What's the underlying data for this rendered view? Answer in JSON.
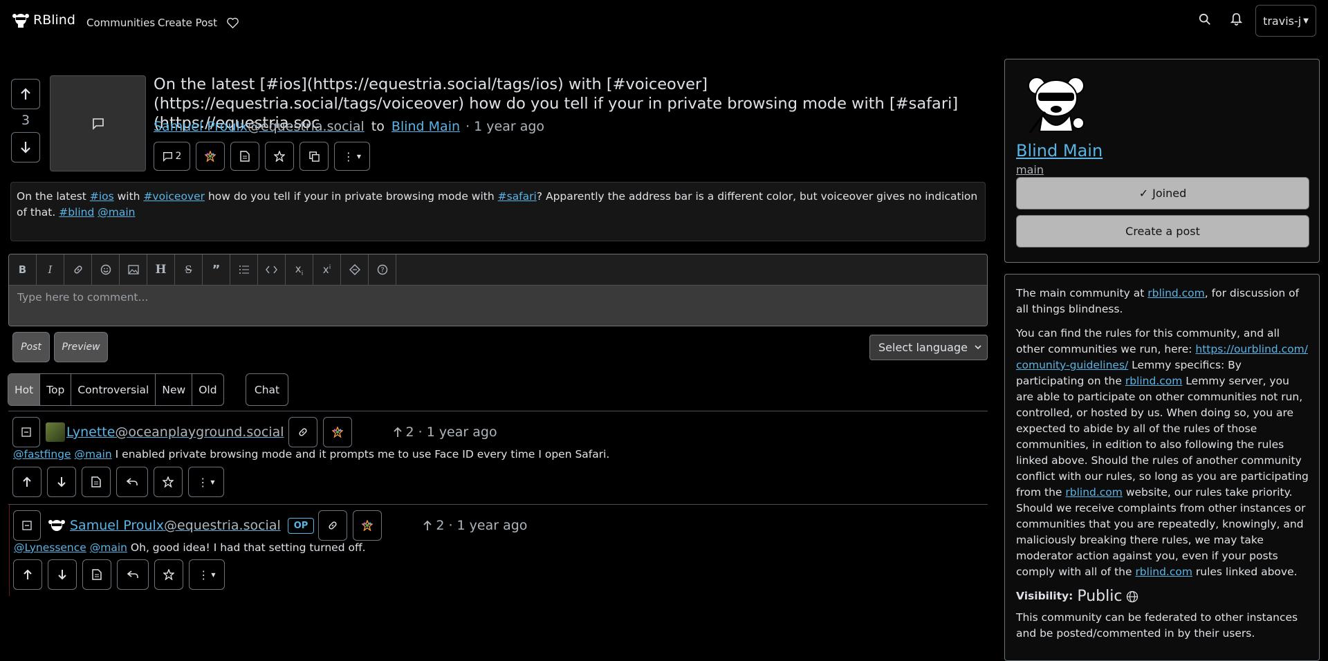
{
  "nav": {
    "brand": "RBlind",
    "communities": "Communities",
    "create_post": "Create Post",
    "user": "travis-j",
    "icons": [
      "heart-icon",
      "search-icon",
      "bell-icon"
    ]
  },
  "post": {
    "score": "3",
    "title": "On the latest [#ios](https://equestria.social/tags/ios) with [#voiceover](https://equestria.social/tags/voiceover) how do you tell if your in private browsing mode with [#safari](https://equestria.soc",
    "author_name": "Samuel Proulx",
    "author_instance": "@equestria.social",
    "to": "to",
    "community": "Blind Main",
    "time": "· 1 year ago",
    "comment_count": "2",
    "body": {
      "t1": "On the latest ",
      "l1": "#ios",
      "t2": " with ",
      "l2": "#voiceover",
      "t3": " how do you tell if your in private browsing mode with ",
      "l3": "#safari",
      "t4": "? Apparently the address bar is a different color, but voiceover gives no indication of that. ",
      "l4": "#blind",
      "t5": " ",
      "l5": "@main"
    }
  },
  "editor": {
    "placeholder": "Type here to comment...",
    "post_label": "Post",
    "preview_label": "Preview",
    "language": "Select language"
  },
  "sort": {
    "options": [
      "Hot",
      "Top",
      "Controversial",
      "New",
      "Old"
    ],
    "active": "Hot",
    "chat": "Chat"
  },
  "comments": [
    {
      "author_name": "Lynette",
      "author_instance": "@oceanplayground.social",
      "score": "2",
      "time": "· 1 year ago",
      "m1": "@fastfinge",
      "m2": "@main",
      "text": " I enabled private browsing mode and it prompts me to use Face ID every time I open Safari."
    },
    {
      "author_name": "Samuel Proulx",
      "author_instance": "@equestria.social",
      "badge": "OP",
      "score": "2",
      "time": "· 1 year ago",
      "m1": "@Lynessence",
      "m2": "@main",
      "text": " Oh, good idea! I had that setting turned off."
    }
  ],
  "sidebar": {
    "community_title": "Blind Main",
    "community_name": "main",
    "joined": "Joined",
    "create_post": "Create a post",
    "d1a": "The main community at ",
    "d1link": "rblind.com",
    "d1b": ", for discussion of all things blindness.",
    "d2a": "You can find the rules for this community, and all other communities we run, here: ",
    "d2link": "https://ourblind.com/comunity-guidelines/",
    "d2b": " Lemmy specifics: By participating on the ",
    "d2link2": "rblind.com",
    "d2c": " Lemmy server, you are able to participate on other communities not run, controlled, or hosted by us. When doing so, you are expected to abide by all of the rules of those communities, in edition to also following the rules linked above. Should the rules of another community conflict with our rules, so long as you are participating from the ",
    "d2link3": "rblind.com",
    "d2d": " website, our rules take priority. Should we receive complaints from other instances or communities that you are repeatedly, knowingly, and maliciously breaking there rules, we may take moderator action against you, even if your posts comply with all of the ",
    "d2link4": "rblind.com",
    "d2e": " rules linked above.",
    "visibility_label": "Visibility:",
    "visibility_value": "Public",
    "federation": "This community can be federated to other instances and be posted/commented in by their users."
  },
  "colors": {
    "link": "#5ab4e6",
    "background": "#000000",
    "button": "#b8b8b8"
  }
}
